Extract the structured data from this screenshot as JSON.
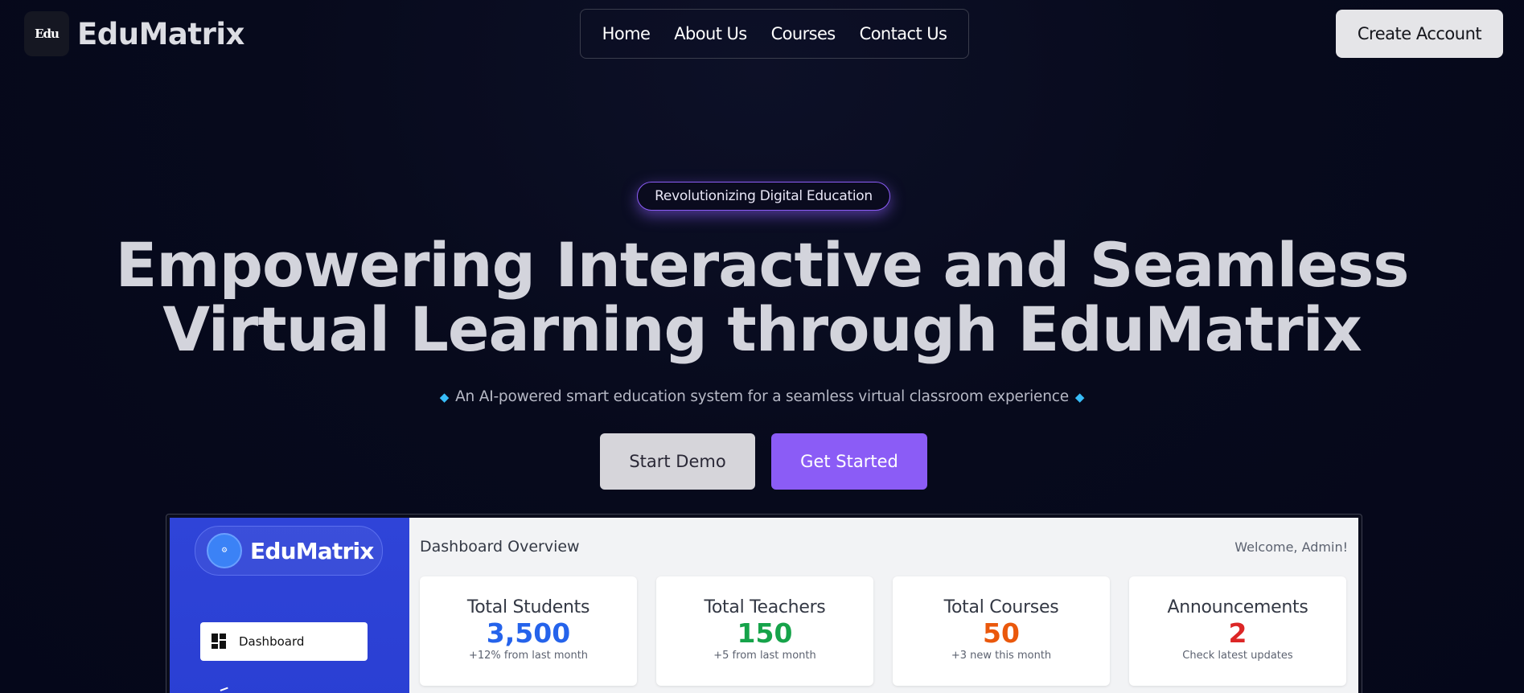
{
  "header": {
    "brand_logo_text": "Edu",
    "brand_name": "EduMatrix",
    "nav": [
      {
        "label": "Home"
      },
      {
        "label": "About Us"
      },
      {
        "label": "Courses"
      },
      {
        "label": "Contact Us"
      }
    ],
    "create_account_label": "Create Account"
  },
  "hero": {
    "badge": "Revolutionizing Digital Education",
    "title_line1": "Empowering Interactive and Seamless",
    "title_line2": "Virtual Learning through EduMatrix",
    "subtitle": "An AI-powered smart education system for a seamless virtual classroom experience",
    "subtitle_icon": "gem-icon",
    "demo_label": "Start Demo",
    "start_label": "Get Started"
  },
  "dashboard_preview": {
    "brand_name": "EduMatrix",
    "nav_item": "Dashboard",
    "title": "Dashboard Overview",
    "welcome": "Welcome, Admin!",
    "cards": [
      {
        "label": "Total Students",
        "value": "3,500",
        "note": "+12% from last month",
        "color": "#2563eb"
      },
      {
        "label": "Total Teachers",
        "value": "150",
        "note": "+5 from last month",
        "color": "#16a34a"
      },
      {
        "label": "Total Courses",
        "value": "50",
        "note": "+3 new this month",
        "color": "#ea580c"
      },
      {
        "label": "Announcements",
        "value": "2",
        "note": "Check latest updates",
        "color": "#dc2626"
      }
    ]
  },
  "colors": {
    "accent": "#8b5cf6",
    "background": "#060818",
    "sidebar": "#2f44d8"
  }
}
